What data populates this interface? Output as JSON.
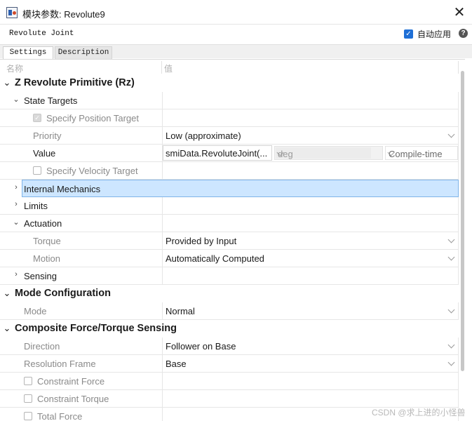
{
  "window": {
    "title": "模块参数: Revolute9",
    "close_glyph": "✕"
  },
  "header": {
    "block_name": "Revolute Joint",
    "auto_apply_label": "自动应用",
    "auto_apply_checked": true,
    "help_glyph": "?"
  },
  "tabs": [
    {
      "label": "Settings",
      "active": true
    },
    {
      "label": "Description",
      "active": false
    }
  ],
  "columns": {
    "name": "名称",
    "value": "值"
  },
  "rows": {
    "z_primitive": "Z Revolute Primitive (Rz)",
    "state_targets": "State Targets",
    "specify_position_target": "Specify Position Target",
    "priority": {
      "label": "Priority",
      "value": "Low (approximate)"
    },
    "value": {
      "label": "Value",
      "expr": "smiData.RevoluteJoint(...",
      "unit": "deg",
      "runtime": "Compile-time"
    },
    "specify_velocity_target": "Specify Velocity Target",
    "internal_mechanics": "Internal Mechanics",
    "limits": "Limits",
    "actuation": "Actuation",
    "torque": {
      "label": "Torque",
      "value": "Provided by Input"
    },
    "motion": {
      "label": "Motion",
      "value": "Automatically Computed"
    },
    "sensing": "Sensing",
    "mode_configuration": "Mode Configuration",
    "mode": {
      "label": "Mode",
      "value": "Normal"
    },
    "composite_sensing": "Composite Force/Torque Sensing",
    "direction": {
      "label": "Direction",
      "value": "Follower on Base"
    },
    "resolution_frame": {
      "label": "Resolution Frame",
      "value": "Base"
    },
    "constraint_force": "Constraint Force",
    "constraint_torque": "Constraint Torque",
    "total_force": "Total Force"
  },
  "watermark": "CSDN @求上进的小怪兽",
  "colors": {
    "selection_bg": "#cde6ff",
    "selection_border": "#7fb4e8",
    "checkbox_accent": "#1f6fd6"
  },
  "icons": [
    "app-icon",
    "close-icon",
    "help-icon",
    "chevron-down-icon",
    "chevron-right-icon",
    "dropdown-caret-icon"
  ]
}
